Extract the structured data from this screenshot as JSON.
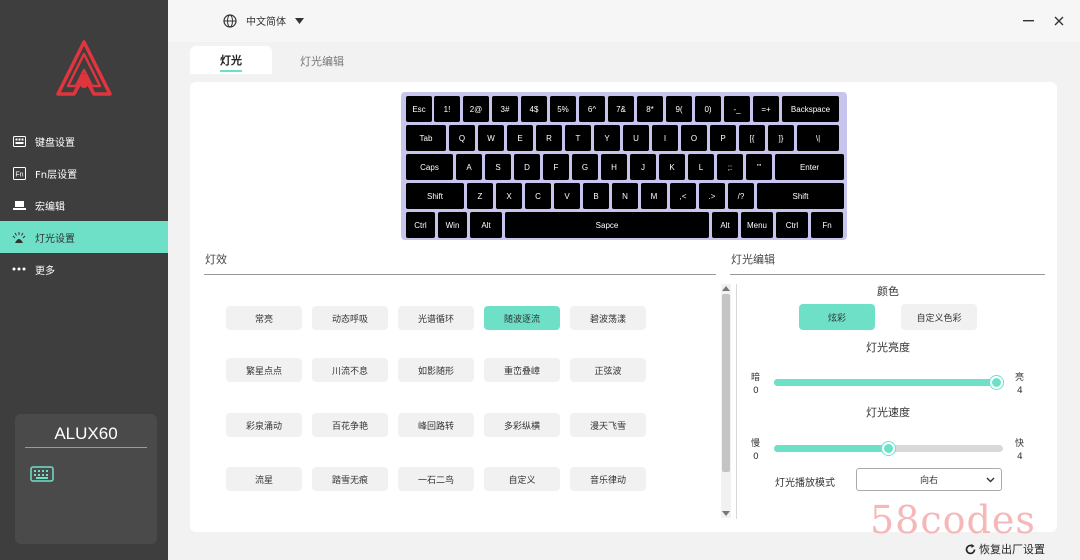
{
  "app": {
    "language": "中文简体",
    "nav": [
      {
        "label": "键盘设置",
        "icon": "keyboard-icon"
      },
      {
        "label": "Fn层设置",
        "icon": "fn-icon"
      },
      {
        "label": "宏编辑",
        "icon": "macro-icon"
      },
      {
        "label": "灯光设置",
        "icon": "light-icon"
      },
      {
        "label": "更多",
        "icon": "more-icon"
      }
    ],
    "active_nav": 3,
    "device": "ALUX60"
  },
  "tabs": [
    "灯光",
    "灯光编辑"
  ],
  "keyboard": {
    "rows": [
      [
        "Esc",
        "1!",
        "2@",
        "3#",
        "4$",
        "5%",
        "6^",
        "7&",
        "8*",
        "9(",
        "0)",
        "-_",
        "=+",
        "Backspace"
      ],
      [
        "Tab",
        "Q",
        "W",
        "E",
        "R",
        "T",
        "Y",
        "U",
        "I",
        "O",
        "P",
        "[{",
        "]}",
        "\\|"
      ],
      [
        "Caps",
        "A",
        "S",
        "D",
        "F",
        "G",
        "H",
        "J",
        "K",
        "L",
        ";:",
        "'\"",
        "Enter"
      ],
      [
        "Shift",
        "Z",
        "X",
        "C",
        "V",
        "B",
        "N",
        "M",
        ",<",
        ".>",
        "/?",
        "Shift"
      ],
      [
        "Ctrl",
        "Win",
        "Alt",
        "Sapce",
        "Alt",
        "Menu",
        "Ctrl",
        "Fn"
      ]
    ]
  },
  "effects": {
    "title": "灯效",
    "items": [
      "常亮",
      "动态呼吸",
      "光谱循环",
      "随波逐流",
      "碧波荡漾",
      "繁星点点",
      "川流不息",
      "如影随形",
      "重峦叠嶂",
      "正弦波",
      "彩泉涌动",
      "百花争艳",
      "峰回路转",
      "多彩纵横",
      "漫天飞雪",
      "流星",
      "踏雪无痕",
      "一石二鸟",
      "自定义",
      "音乐律动"
    ],
    "active": 3
  },
  "edit": {
    "title": "灯光编辑",
    "color_label": "颜色",
    "color_options": [
      "炫彩",
      "自定义色彩"
    ],
    "color_active": 0,
    "brightness": {
      "label": "灯光亮度",
      "min_label": "暗",
      "max_label": "亮",
      "min": "0",
      "max": "4",
      "value": 4
    },
    "speed": {
      "label": "灯光速度",
      "min_label": "慢",
      "max_label": "快",
      "min": "0",
      "max": "4",
      "value": 2
    },
    "mode_label": "灯光播放模式",
    "mode_value": "向右"
  },
  "reset_label": "恢复出厂设置",
  "watermark": "58codes",
  "colors": {
    "accent": "#6ee0c8",
    "sidebar": "#3e3e3e",
    "keycap": "#000000",
    "keyboard_frame": "#c7c4ee"
  }
}
